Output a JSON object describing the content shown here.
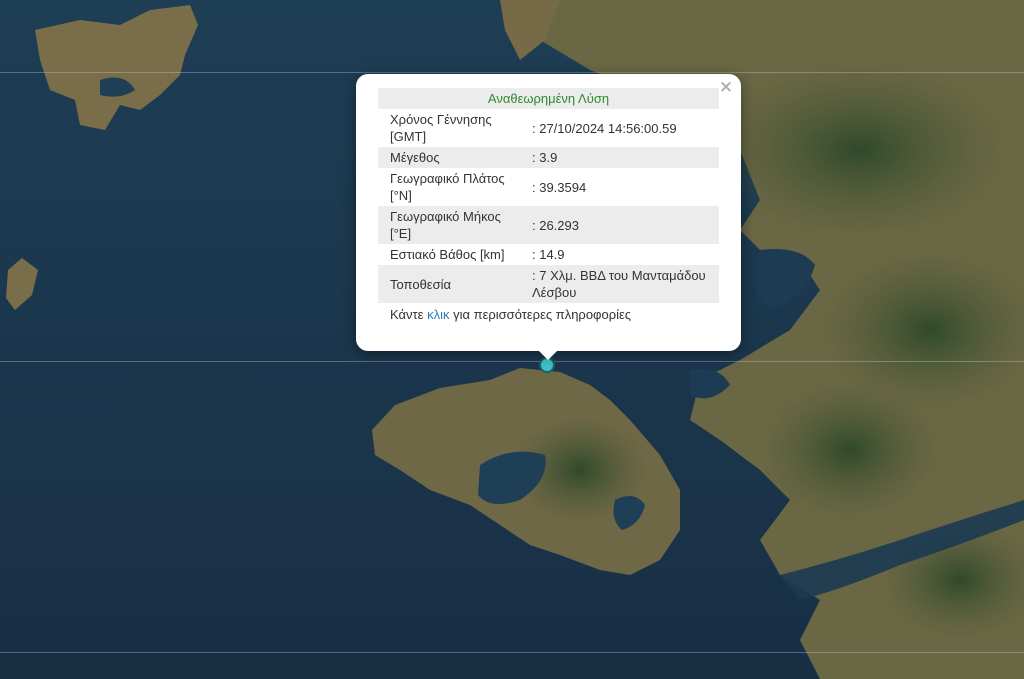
{
  "popup": {
    "title": "Αναθεωρημένη Λύση",
    "rows": [
      {
        "label": "Χρόνος Γέννησης [GMT]",
        "value": ": 27/10/2024 14:56:00.59"
      },
      {
        "label": "Μέγεθος",
        "value": ": 3.9"
      },
      {
        "label": "Γεωγραφικό Πλάτος [°N]",
        "value": ": 39.3594"
      },
      {
        "label": "Γεωγραφικό Μήκος [°E]",
        "value": ": 26.293"
      },
      {
        "label": "Εστιακό Βάθος [km]",
        "value": ": 14.9"
      },
      {
        "label": "Τοποθεσία",
        "value": ": 7 Χλμ. ΒΒΔ του Μανταμάδου Λέσβου"
      }
    ],
    "more_prefix": "Κάντε ",
    "more_link": "κλικ",
    "more_suffix": " για περισσότερες πληροφορίες",
    "close_glyph": "×"
  },
  "colors": {
    "sea": "#1b3a52",
    "land": "#6b6a47",
    "marker": "#3fc0c8",
    "title": "#2e8b2e",
    "link": "#2a7fb8"
  }
}
